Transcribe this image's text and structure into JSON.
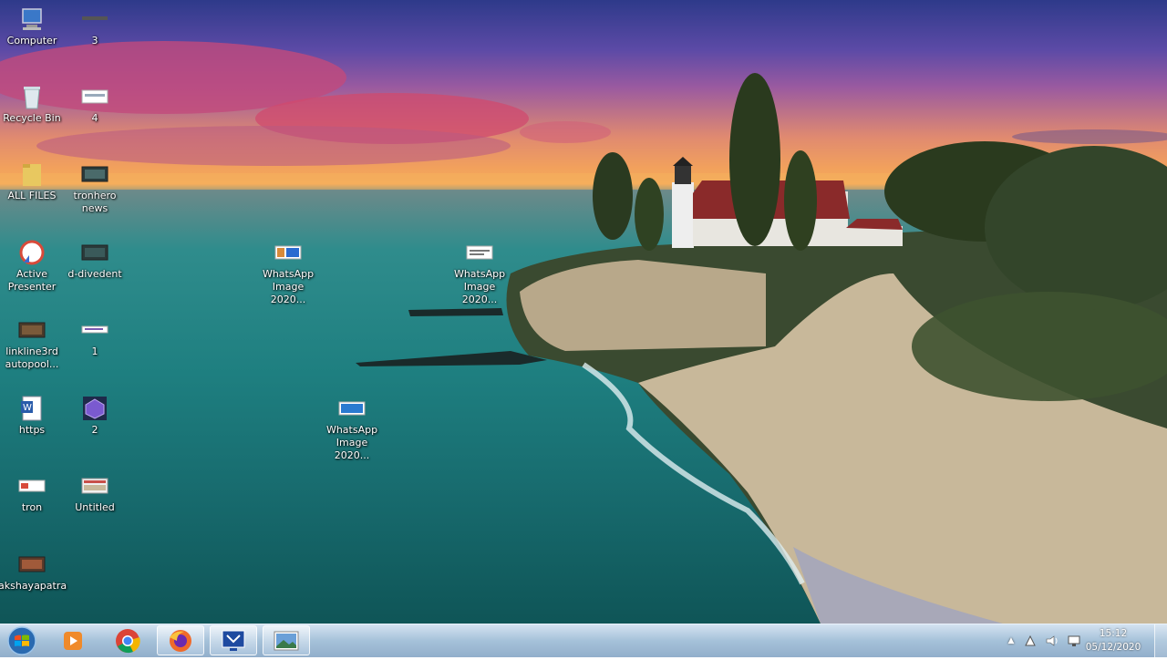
{
  "desktop": {
    "icons": [
      {
        "label": "Computer"
      },
      {
        "label": "3"
      },
      {
        "label": "Recycle Bin"
      },
      {
        "label": "4"
      },
      {
        "label": "ALL FILES"
      },
      {
        "label": "tronhero\nnews"
      },
      {
        "label": "Active\nPresenter"
      },
      {
        "label": "d-divedent"
      },
      {
        "label": "WhatsApp\nImage 2020..."
      },
      {
        "label": "WhatsApp\nImage 2020..."
      },
      {
        "label": "linkline3rd\nautopool..."
      },
      {
        "label": "1"
      },
      {
        "label": "https"
      },
      {
        "label": "2"
      },
      {
        "label": "WhatsApp\nImage 2020..."
      },
      {
        "label": "tron"
      },
      {
        "label": "Untitled"
      },
      {
        "label": "akshayapatra"
      }
    ]
  },
  "taskbar": {
    "pinned": [
      {
        "name": "media-player-icon"
      },
      {
        "name": "chrome-icon"
      },
      {
        "name": "firefox-icon"
      },
      {
        "name": "presenter-icon"
      },
      {
        "name": "image-viewer-icon"
      }
    ],
    "clock": {
      "time": "15:12",
      "date": "05/12/2020"
    }
  }
}
